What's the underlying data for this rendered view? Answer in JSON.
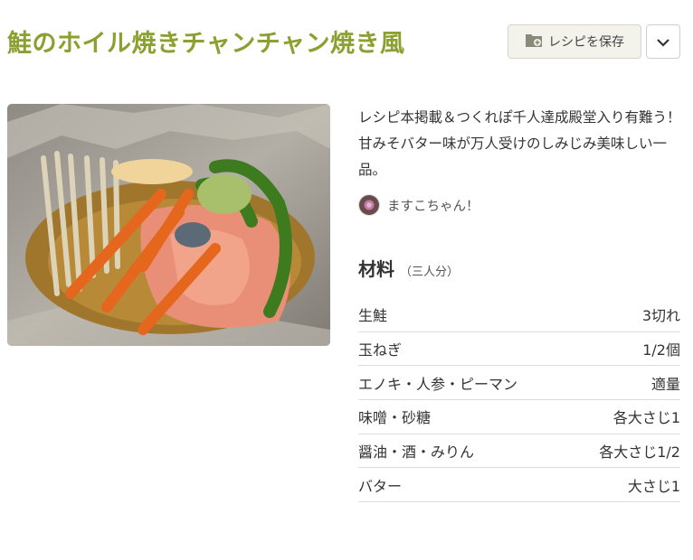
{
  "recipe": {
    "title": "鮭のホイル焼きチャンチャン焼き風",
    "save_label": "レシピを保存",
    "description": "レシピ本掲載＆つくれぽ千人達成殿堂入り有難う！ 甘みそバター味が万人受けのしみじみ美味しい一品。",
    "author": "ますこちゃん！"
  },
  "icons": {
    "save": "folder-plus-icon",
    "menu": "chevron-down-icon"
  },
  "ingredients": {
    "title": "材料",
    "serving": "（三人分）",
    "items": [
      {
        "name": "生鮭",
        "qty": "3切れ"
      },
      {
        "name": "玉ねぎ",
        "qty": "1/2個"
      },
      {
        "name": "エノキ・人参・ピーマン",
        "qty": "適量"
      },
      {
        "name": "味噌・砂糖",
        "qty": "各大さじ1"
      },
      {
        "name": "醤油・酒・みりん",
        "qty": "各大さじ1/2"
      },
      {
        "name": "バター",
        "qty": "大さじ1"
      }
    ]
  },
  "colors": {
    "title": "#8aa02f",
    "save_button_bg": "#f3f3ec"
  }
}
